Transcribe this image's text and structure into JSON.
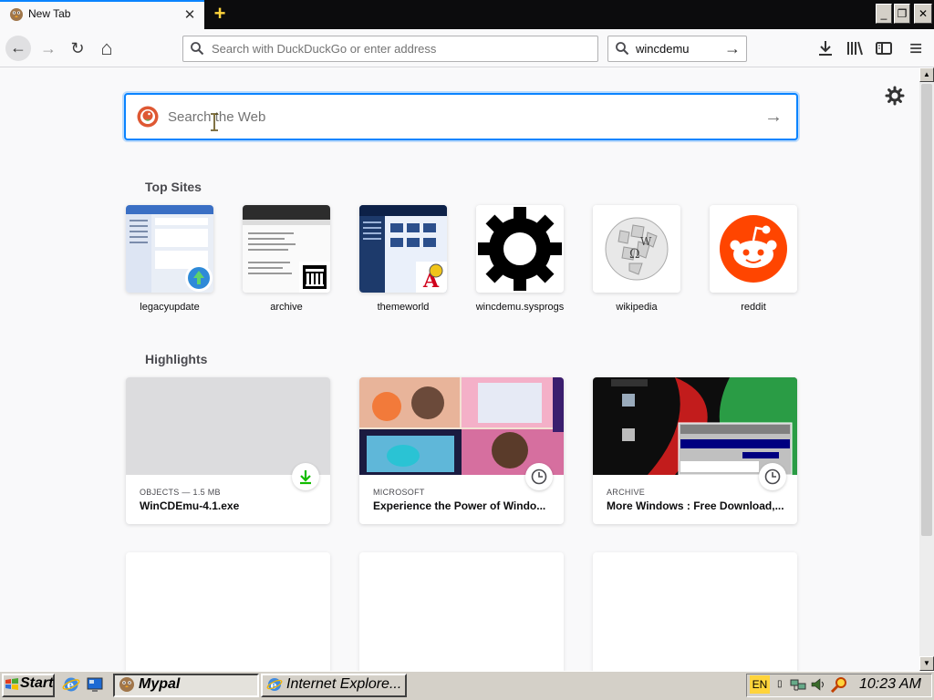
{
  "window": {
    "tab_title": "New Tab",
    "tab_close": "✕",
    "new_tab": "+",
    "min": "_",
    "max": "❐",
    "close": "✕"
  },
  "navbar": {
    "back": "←",
    "forward": "→",
    "reload": "↻",
    "home": "⌂",
    "url_placeholder": "Search with DuckDuckGo or enter address",
    "search_value": "wincdemu",
    "search_go": "→"
  },
  "content": {
    "web_search_placeholder": "Search the Web",
    "web_search_go": "→",
    "top_sites_title": "Top Sites",
    "highlights_title": "Highlights",
    "top_sites": [
      {
        "label": "legacyupdate"
      },
      {
        "label": "archive"
      },
      {
        "label": "themeworld"
      },
      {
        "label": "wincdemu.sysprogs"
      },
      {
        "label": "wikipedia"
      },
      {
        "label": "reddit"
      }
    ],
    "highlights": [
      {
        "source": "OBJECTS — 1.5 MB",
        "title": "WinCDEmu-4.1.exe"
      },
      {
        "source": "MICROSOFT",
        "title": "Experience the Power of Windo..."
      },
      {
        "source": "ARCHIVE",
        "title": "More Windows : Free Download,..."
      }
    ]
  },
  "taskbar": {
    "start": "Start",
    "mypal": "Mypal",
    "ie": "Internet Explore...",
    "lang": "EN",
    "clock": "10:23 AM"
  },
  "colors": {
    "accent": "#0a84ff",
    "tab_bar": "#0c0c0d",
    "taskbar": "#d4d0c8",
    "reddit": "#ff4500",
    "download_green": "#12bc00"
  }
}
